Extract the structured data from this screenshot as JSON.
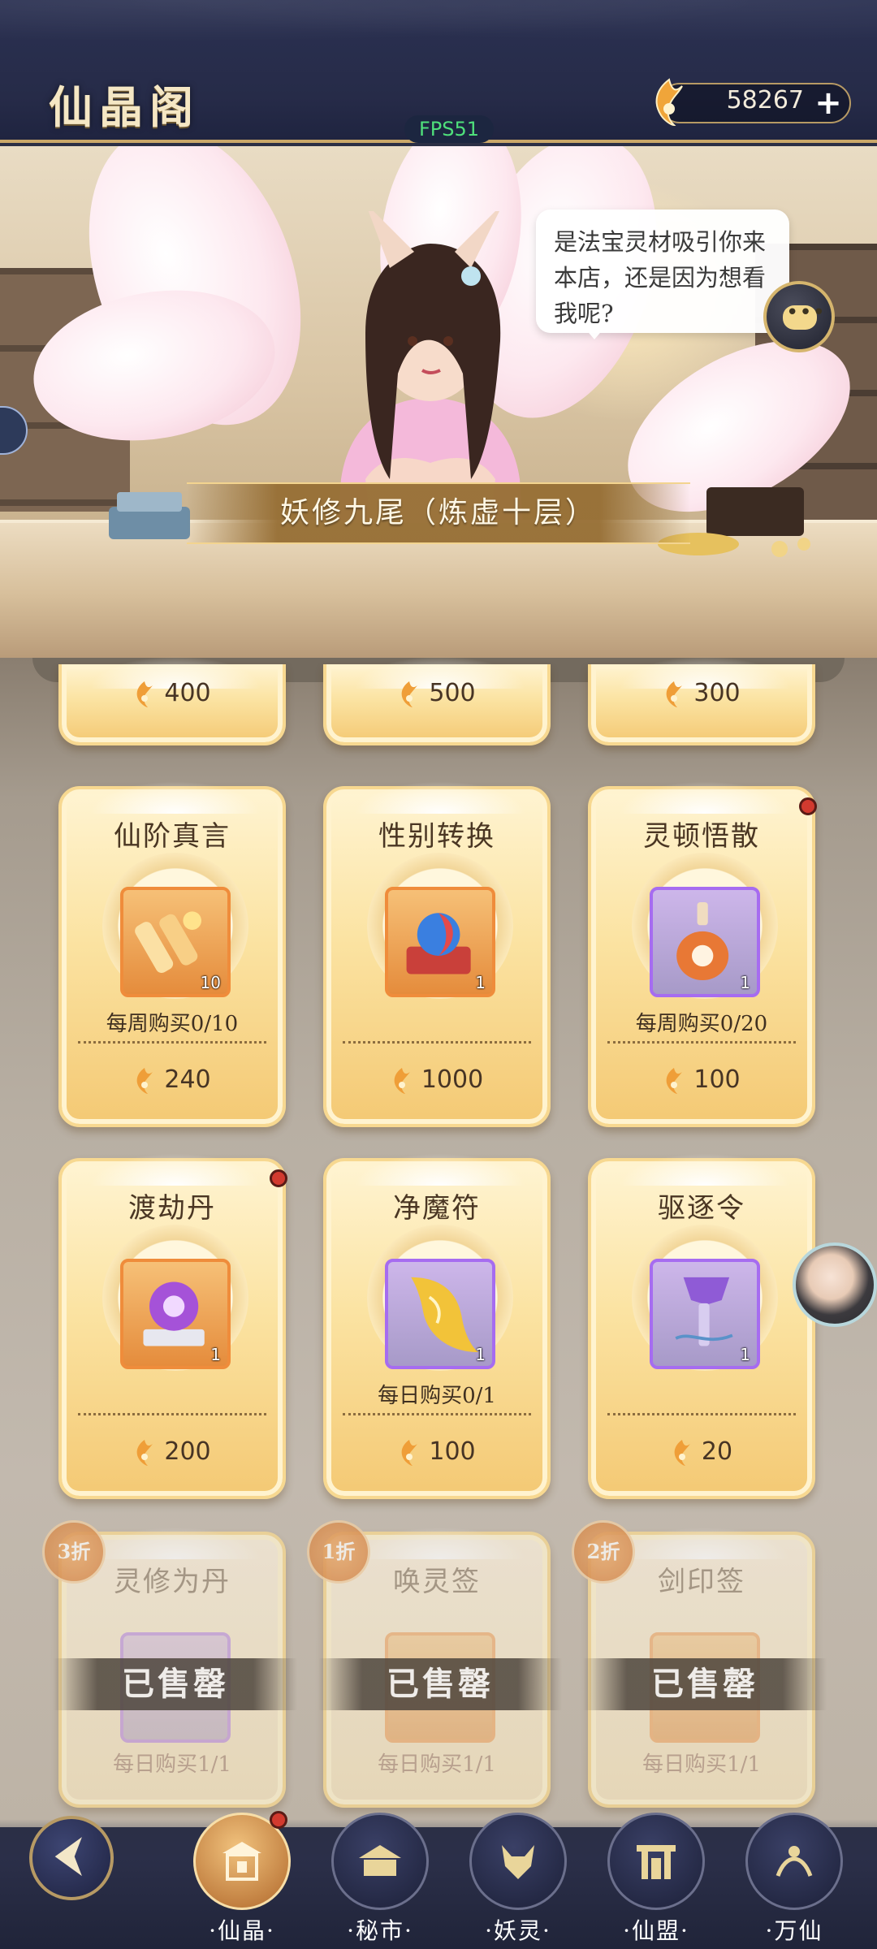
{
  "header": {
    "title": "仙晶阁",
    "currency_amount": "58267",
    "add_label": "+",
    "fps": "FPS51"
  },
  "scene": {
    "npc_name": "妖修九尾（炼虚十层）",
    "speech": "是法宝灵材吸引你来本店，还是因为想看我呢?"
  },
  "shop": {
    "partial_row": [
      {
        "price": "400"
      },
      {
        "price": "500"
      },
      {
        "price": "300"
      }
    ],
    "row1": [
      {
        "name": "仙阶真言",
        "count": "10",
        "limit": "每周购买0/10",
        "price": "240",
        "badge": false
      },
      {
        "name": "性别转换",
        "count": "1",
        "limit": "",
        "price": "1000",
        "badge": false
      },
      {
        "name": "灵顿悟散",
        "count": "1",
        "limit": "每周购买0/20",
        "price": "100",
        "badge": true
      }
    ],
    "row2": [
      {
        "name": "渡劫丹",
        "count": "1",
        "limit": "",
        "price": "200",
        "badge": true
      },
      {
        "name": "净魔符",
        "count": "1",
        "limit": "每日购买0/1",
        "price": "100",
        "badge": false
      },
      {
        "name": "驱逐令",
        "count": "1",
        "limit": "",
        "price": "20",
        "badge": false
      }
    ],
    "row3": [
      {
        "name": "灵修为丹",
        "discount": "3折",
        "sold": "已售罄",
        "limit": "每日购买1/1"
      },
      {
        "name": "唤灵签",
        "discount": "1折",
        "sold": "已售罄",
        "limit": "每日购买1/1"
      },
      {
        "name": "剑印签",
        "discount": "2折",
        "sold": "已售罄",
        "limit": "每日购买1/1"
      }
    ]
  },
  "nav": {
    "items": [
      {
        "label": "·仙晶·",
        "active": true,
        "badge": true
      },
      {
        "label": "·秘市·",
        "active": false,
        "badge": false
      },
      {
        "label": "·妖灵·",
        "active": false,
        "badge": false
      },
      {
        "label": "·仙盟·",
        "active": false,
        "badge": false
      },
      {
        "label": "·万仙",
        "active": false,
        "badge": false
      }
    ]
  },
  "colors": {
    "accent_gold": "#f4c974",
    "header_bg": "#262b48",
    "badge_red": "#d23a2f"
  }
}
